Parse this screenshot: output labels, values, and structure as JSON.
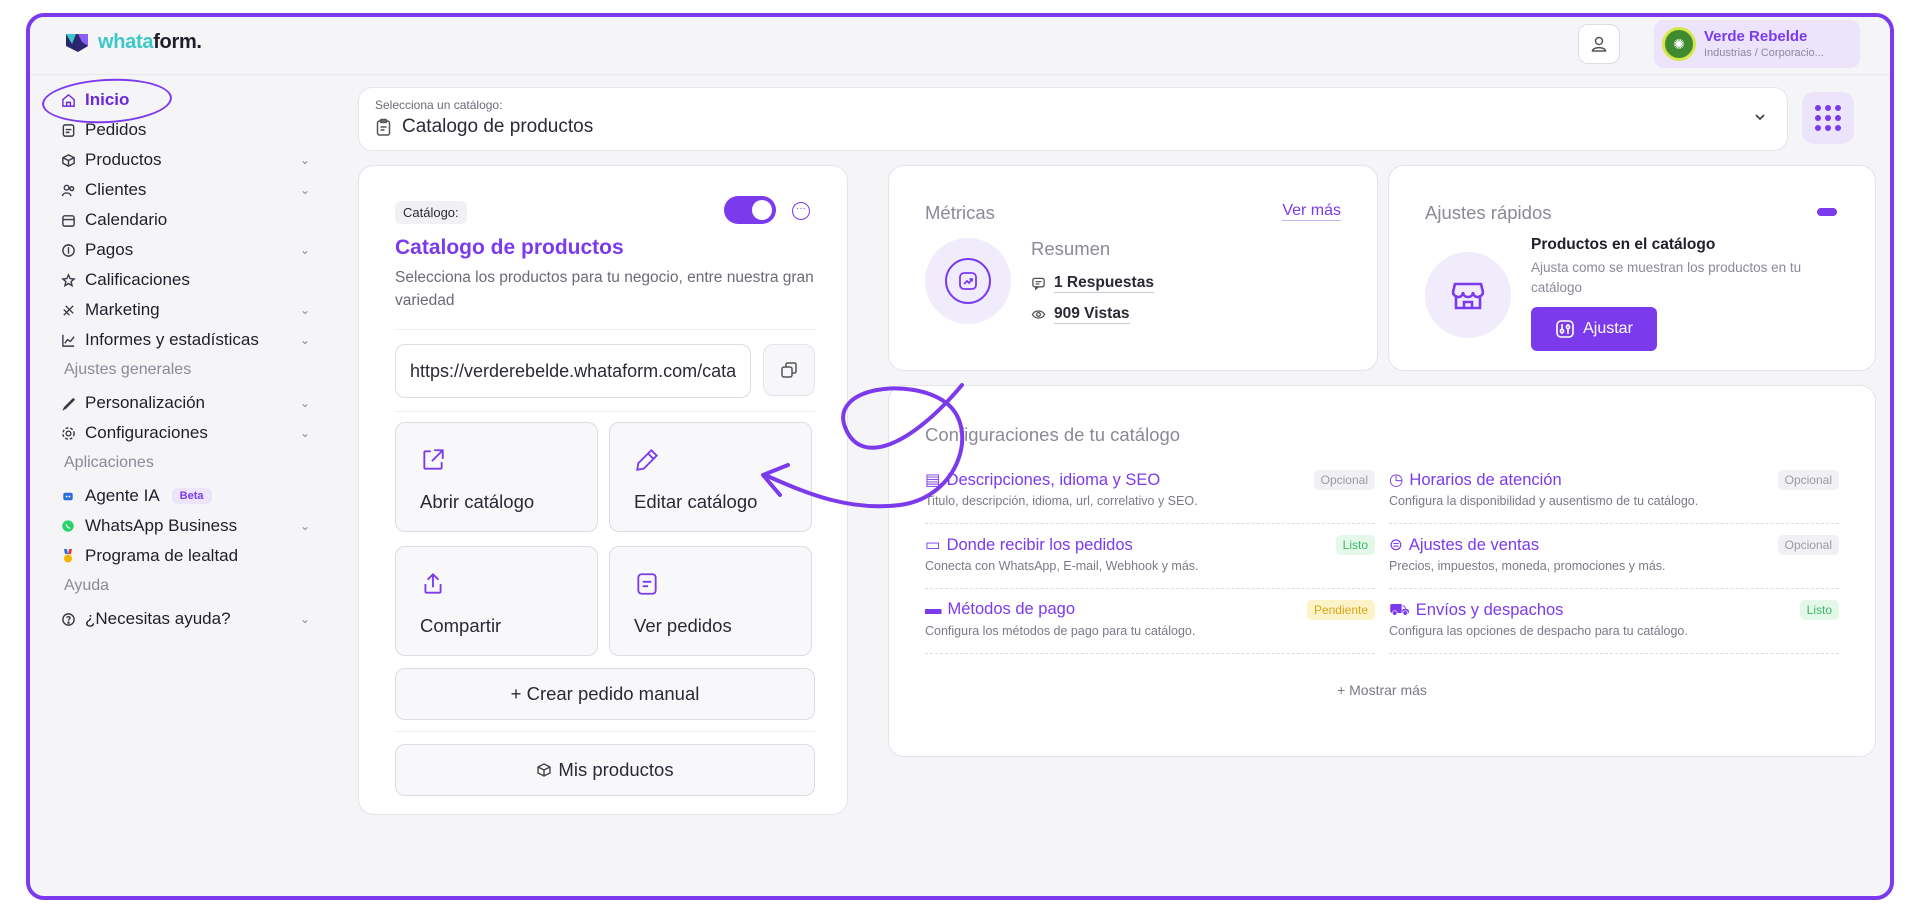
{
  "header": {
    "logo_prefix": "whata",
    "logo_suffix": "form.",
    "account": {
      "name": "Verde Rebelde",
      "subtitle": "Industrias / Corporacio..."
    }
  },
  "sidebar": {
    "items": [
      {
        "label": "Inicio",
        "icon": "home-icon"
      },
      {
        "label": "Pedidos",
        "icon": "orders-icon"
      },
      {
        "label": "Productos",
        "icon": "products-icon"
      },
      {
        "label": "Clientes",
        "icon": "clients-icon"
      },
      {
        "label": "Calendario",
        "icon": "calendar-icon"
      },
      {
        "label": "Pagos",
        "icon": "payments-icon"
      },
      {
        "label": "Calificaciones",
        "icon": "star-icon"
      },
      {
        "label": "Marketing",
        "icon": "marketing-icon"
      },
      {
        "label": "Informes y estadísticas",
        "icon": "chart-icon"
      }
    ],
    "section_settings": "Ajustes generales",
    "settings_items": [
      {
        "label": "Personalización",
        "icon": "brush-icon"
      },
      {
        "label": "Configuraciones",
        "icon": "gear-icon"
      }
    ],
    "section_apps": "Aplicaciones",
    "apps_items": [
      {
        "label": "Agente IA",
        "badge": "Beta",
        "icon": "robot-icon"
      },
      {
        "label": "WhatsApp Business",
        "icon": "whatsapp-icon"
      },
      {
        "label": "Programa de lealtad",
        "icon": "medal-icon"
      }
    ],
    "section_help": "Ayuda",
    "help_items": [
      {
        "label": "¿Necesitas ayuda?",
        "icon": "help-icon"
      }
    ]
  },
  "selector": {
    "label": "Selecciona un catálogo:",
    "value": "Catalogo de productos"
  },
  "catalog_card": {
    "tag": "Catálogo:",
    "title": "Catalogo de productos",
    "description": "Selecciona los productos para tu negocio, entre nuestra gran variedad",
    "url": "https://verderebelde.whataform.com/catalogo",
    "toggle_on": true,
    "tiles": [
      {
        "label": "Abrir catálogo"
      },
      {
        "label": "Editar catálogo"
      },
      {
        "label": "Compartir"
      },
      {
        "label": "Ver pedidos"
      }
    ],
    "create_manual": "+ Crear pedido manual",
    "my_products": "Mis productos"
  },
  "metrics": {
    "title": "Métricas",
    "see_more": "Ver más",
    "summary": "Resumen",
    "responses": "1 Respuestas",
    "views": "909 Vistas"
  },
  "quick": {
    "title": "Ajustes rápidos",
    "item_title": "Productos en el catálogo",
    "item_desc": "Ajusta como se muestran los productos en tu catálogo",
    "button": "Ajustar"
  },
  "config": {
    "title": "Configuraciones de tu catálogo",
    "items": [
      {
        "name": "Descripciones, idioma y SEO",
        "desc": "Titulo, descripción, idioma, url, correlativo y SEO.",
        "badge": "Opcional",
        "status": "opcional"
      },
      {
        "name": "Horarios de atención",
        "desc": "Configura la disponibilidad y ausentismo de tu catálogo.",
        "badge": "Opcional",
        "status": "opcional"
      },
      {
        "name": "Donde recibir los pedidos",
        "desc": "Conecta con WhatsApp, E-mail, Webhook y más.",
        "badge": "Listo",
        "status": "listo"
      },
      {
        "name": "Ajustes de ventas",
        "desc": "Precios, impuestos, moneda, promociones y más.",
        "badge": "Opcional",
        "status": "opcional"
      },
      {
        "name": "Métodos de pago",
        "desc": "Configura los métodos de pago para tu catálogo.",
        "badge": "Pendiente",
        "status": "pendiente"
      },
      {
        "name": "Envíos y despachos",
        "desc": "Configura las opciones de despacho para tu catálogo.",
        "badge": "Listo",
        "status": "listo"
      }
    ],
    "show_more": "+ Mostrar más"
  },
  "colors": {
    "accent": "#7c3aed",
    "success": "#3cb765",
    "warning": "#d9a516"
  }
}
